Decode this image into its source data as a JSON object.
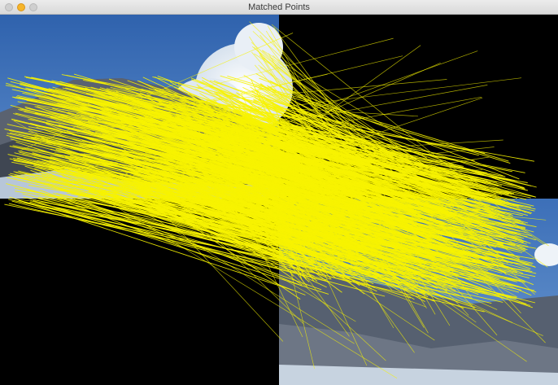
{
  "window": {
    "title": "Matched Points",
    "buttons": {
      "close": "close-button",
      "minimize": "minimize-button",
      "zoom": "zoom-button"
    }
  },
  "colors": {
    "match_lines": "#f7f300",
    "background": "#000000",
    "sky": "#3b6fb6"
  }
}
